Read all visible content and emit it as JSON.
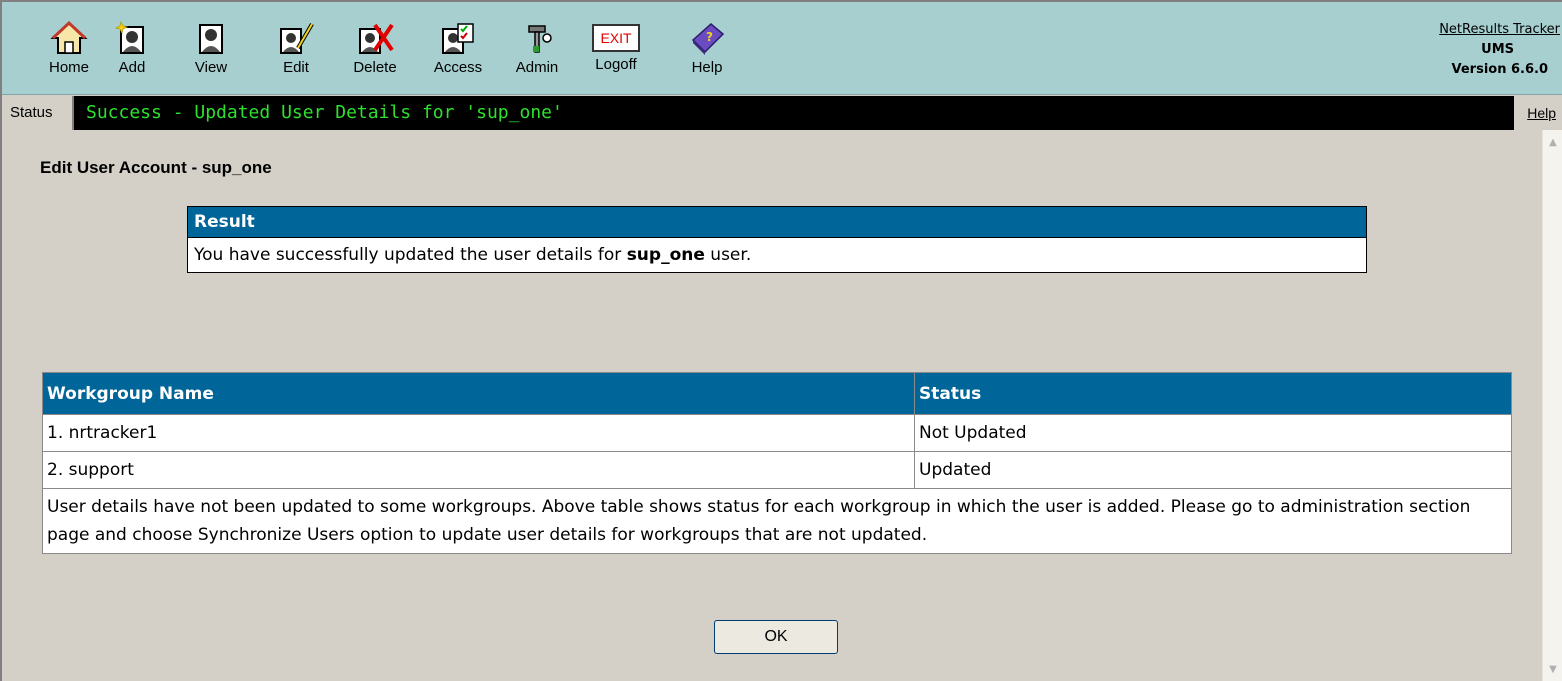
{
  "toolbar": {
    "items": [
      {
        "label": "Home",
        "icon": "home-icon"
      },
      {
        "label": "Add",
        "icon": "add-user-icon"
      },
      {
        "label": "View",
        "icon": "view-user-icon"
      },
      {
        "label": "Edit",
        "icon": "edit-user-icon"
      },
      {
        "label": "Delete",
        "icon": "delete-user-icon"
      },
      {
        "label": "Access",
        "icon": "access-icon"
      },
      {
        "label": "Admin",
        "icon": "admin-tools-icon"
      },
      {
        "label": "Logoff",
        "icon": "exit-sign-icon"
      },
      {
        "label": "Help",
        "icon": "help-book-icon"
      }
    ],
    "exit_sign_text": "EXIT"
  },
  "brand": {
    "product_link": "NetResults Tracker",
    "app": "UMS",
    "version": "Version 6.6.0"
  },
  "statusbar": {
    "label": "Status",
    "message": "Success - Updated User Details for 'sup_one'",
    "help": "Help"
  },
  "page": {
    "title": "Edit User Account - sup_one"
  },
  "result": {
    "header": "Result",
    "text_before": "You have successfully updated the user details for ",
    "username": "sup_one",
    "text_after": " user."
  },
  "workgroups": {
    "col_name": "Workgroup Name",
    "col_status": "Status",
    "rows": [
      {
        "name": "1. nrtracker1",
        "status": "Not Updated"
      },
      {
        "name": "2. support",
        "status": "Updated"
      }
    ],
    "note": "User details have not been updated to some workgroups. Above table shows status for each workgroup in which the user is added. Please go to administration section page and choose Synchronize Users option to update user details for workgroups that are not updated."
  },
  "ok_button": "OK",
  "colors": {
    "toolbar_bg": "#a7cfd0",
    "header_blue": "#006699",
    "status_green": "#2ee02e",
    "page_bg": "#d4d0c8"
  }
}
